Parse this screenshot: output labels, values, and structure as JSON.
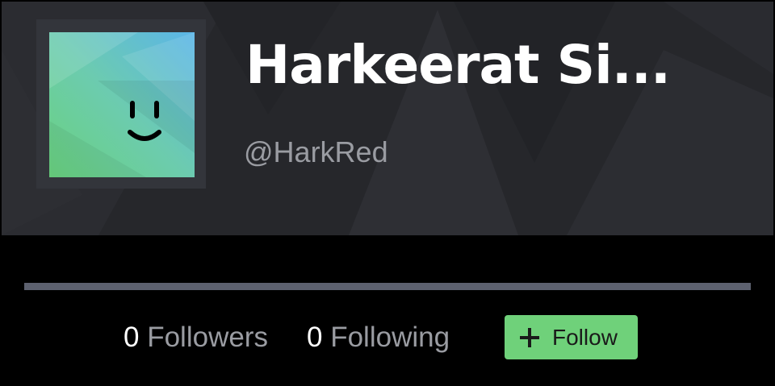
{
  "profile": {
    "name": "Harkeerat Si...",
    "handle": "@HarkRed",
    "followers_count": "0",
    "followers_label": "Followers",
    "following_count": "0",
    "following_label": "Following"
  },
  "actions": {
    "follow_label": "Follow",
    "follow_icon": "plus-icon"
  },
  "colors": {
    "banner_bg": "#26272b",
    "page_bg": "#000000",
    "divider": "#5d616f",
    "follow_button": "#6fd17a",
    "muted_text": "#9a9ca2"
  }
}
